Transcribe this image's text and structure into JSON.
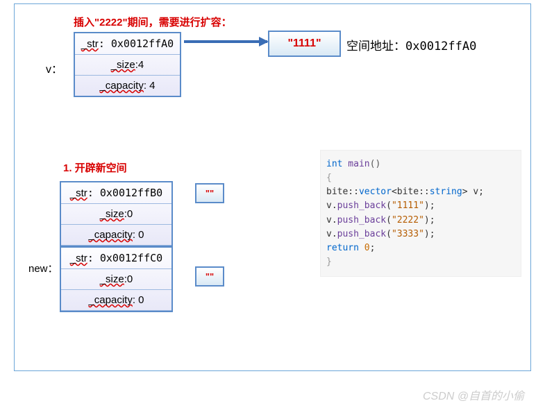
{
  "title1": "插入\"2222\"期间，需要进行扩容：",
  "vlabel": "v：",
  "struct1": {
    "r1_label": "_str",
    "r1_val": ": 0x0012ffA0",
    "r2_label": "_size",
    "r2_val": ":4",
    "r3_label": "_capacity",
    "r3_val": ": 4"
  },
  "val1": "\"1111\"",
  "addr_label": "空间地址：",
  "addr_val": "0x0012ffA0",
  "title2": "1. 开辟新空间",
  "newlabel": "new：",
  "structA": {
    "r1_label": "_str",
    "r1_val": ": 0x0012ffB0",
    "r2_label": "_size",
    "r2_val": ":0",
    "r3_label": "_capacity",
    "r3_val": ": 0"
  },
  "structB": {
    "r1_label": "_str",
    "r1_val": ": 0x0012ffC0",
    "r2_label": "_size",
    "r2_val": ":0",
    "r3_label": "_capacity",
    "r3_val": ": 0"
  },
  "smallval": "\"\"",
  "code": {
    "l1_kw": "int",
    "l1_fn": " main",
    "l1_end": "()",
    "l2": "{",
    "l3a": "    bite::",
    "l3b": "vector",
    "l3c": "<bite::",
    "l3d": "string",
    "l3e": "> v;",
    "l4a": "    v.",
    "l4b": "push_back",
    "l4c": "(",
    "l4d": "\"1111\"",
    "l4e": ");",
    "l5a": "    v.",
    "l5b": "push_back",
    "l5c": "(",
    "l5d": "\"2222\"",
    "l5e": ");",
    "l6a": "    v.",
    "l6b": "push_back",
    "l6c": "(",
    "l6d": "\"3333\"",
    "l6e": ");",
    "l7a": "    return ",
    "l7b": "0",
    "l7c": ";",
    "l8": "}"
  },
  "watermark": "CSDN @自首的小偷"
}
